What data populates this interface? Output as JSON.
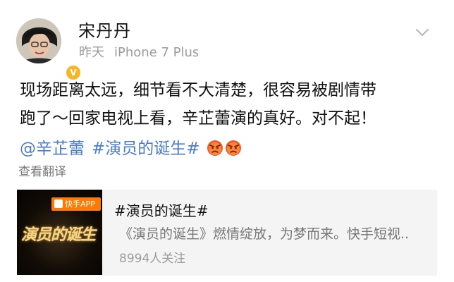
{
  "post": {
    "user": {
      "name": "宋丹丹",
      "verified_badge": "V",
      "avatar_icon": "user-avatar"
    },
    "meta": {
      "time": "昨天",
      "device": "iPhone 7 Plus"
    },
    "menu_icon": "chevron-down-icon",
    "text_lines": [
      "现场距离太远，细节看不大清楚，很容易被剧情带",
      "跑了～回家电视上看，辛芷蕾演的真好。对不起！"
    ],
    "mention": "@辛芷蕾",
    "hashtag": "#演员的诞生#",
    "emojis": [
      "angry-face-icon",
      "angry-face-icon"
    ],
    "translate_label": "查看翻译"
  },
  "card": {
    "thumbnail": {
      "app_badge": "快手APP",
      "title_art": "演员的诞生"
    },
    "title": "#演员的诞生#",
    "description": "《演员的诞生》燃情绽放，为梦而来。快手短视..",
    "followers": "8994人关注"
  },
  "colors": {
    "link": "#4d7cc7",
    "text": "#111111",
    "muted": "#9b9b9b",
    "card_bg": "#f4f4f4",
    "badge": "#f5b62a",
    "kuaishou": "#ff7a00"
  }
}
